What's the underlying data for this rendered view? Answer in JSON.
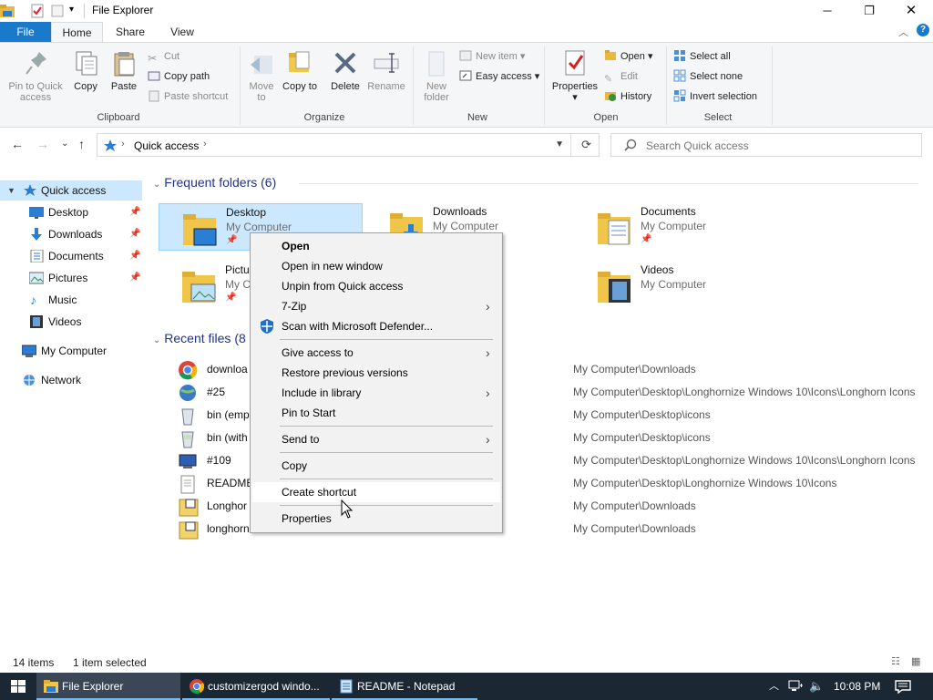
{
  "window": {
    "title": "File Explorer"
  },
  "ribbon_tabs": [
    "File",
    "Home",
    "Share",
    "View"
  ],
  "ribbon": {
    "pin_to_quick_access": "Pin to Quick access",
    "copy": "Copy",
    "paste": "Paste",
    "cut": "Cut",
    "copy_path": "Copy path",
    "paste_shortcut": "Paste shortcut",
    "clipboard": "Clipboard",
    "move_to": "Move to",
    "copy_to": "Copy to",
    "delete": "Delete",
    "rename": "Rename",
    "organize": "Organize",
    "new_folder": "New folder",
    "new_item": "New item",
    "easy_access": "Easy access",
    "new": "New",
    "properties": "Properties",
    "open": "Open",
    "edit": "Edit",
    "history": "History",
    "open_group": "Open",
    "select_all": "Select all",
    "select_none": "Select none",
    "invert_selection": "Invert selection",
    "select": "Select"
  },
  "address": {
    "crumb": "Quick access",
    "search_placeholder": "Search Quick access"
  },
  "navpane": {
    "items": [
      "Quick access",
      "Desktop",
      "Downloads",
      "Documents",
      "Pictures",
      "Music",
      "Videos",
      "My Computer",
      "Network"
    ]
  },
  "content": {
    "frequent_header": "Frequent folders (6)",
    "recent_header": "Recent files (8",
    "folders": [
      {
        "name": "Desktop",
        "sub": "My Computer"
      },
      {
        "name": "Downloads",
        "sub": "My Computer"
      },
      {
        "name": "Documents",
        "sub": "My Computer"
      },
      {
        "name": "Pictu",
        "sub": "My C"
      },
      {
        "name": "Videos",
        "sub": "My Computer"
      }
    ],
    "recent": [
      {
        "name": "downloa",
        "path": "My Computer\\Downloads"
      },
      {
        "name": "#25",
        "path": "My Computer\\Desktop\\Longhornize Windows 10\\Icons\\Longhorn Icons"
      },
      {
        "name": "bin (emp",
        "path": "My Computer\\Desktop\\icons"
      },
      {
        "name": "bin (with",
        "path": "My Computer\\Desktop\\icons"
      },
      {
        "name": "#109",
        "path": "My Computer\\Desktop\\Longhornize Windows 10\\Icons\\Longhorn Icons"
      },
      {
        "name": "README",
        "path": "My Computer\\Desktop\\Longhornize Windows 10\\Icons"
      },
      {
        "name": "Longhor",
        "path": "My Computer\\Downloads"
      },
      {
        "name": "longhorn",
        "path": "My Computer\\Downloads"
      }
    ]
  },
  "context_menu": {
    "items": [
      "Open",
      "Open in new window",
      "Unpin from Quick access",
      "7-Zip",
      "Scan with Microsoft Defender...",
      "Give access to",
      "Restore previous versions",
      "Include in library",
      "Pin to Start",
      "Send to",
      "Copy",
      "Create shortcut",
      "Properties"
    ]
  },
  "status": {
    "count": "14 items",
    "selected": "1 item selected"
  },
  "taskbar": {
    "items": [
      "File Explorer",
      "customizergod windo...",
      "README - Notepad"
    ],
    "clock": "10:08 PM"
  },
  "colors": {
    "accent": "#1979ca",
    "selection": "#cce8ff",
    "taskbar": "#1c2734",
    "header_blue": "#1e3287"
  }
}
